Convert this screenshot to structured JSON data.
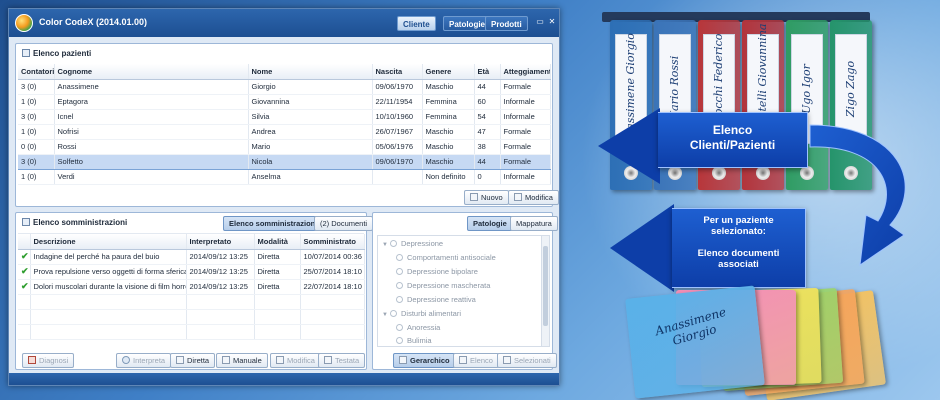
{
  "app": {
    "title": "Color CodeX (2014.01.00)",
    "nav_tabs": [
      "Cliente",
      "Patologie",
      "Prodotti"
    ],
    "active_tab": "Cliente",
    "window_controls": [
      "▭",
      "✕"
    ]
  },
  "patients": {
    "title": "Elenco pazienti",
    "columns": [
      "Contatori",
      "Cognome",
      "Nome",
      "Nascita",
      "Genere",
      "Età",
      "Atteggiamento"
    ],
    "rows": [
      [
        "3 (0)",
        "Anassimene",
        "Giorgio",
        "09/06/1970",
        "Maschio",
        "44",
        "Formale"
      ],
      [
        "1 (0)",
        "Eptagora",
        "Giovannina",
        "22/11/1954",
        "Femmina",
        "60",
        "Informale"
      ],
      [
        "3 (0)",
        "Icnel",
        "Silvia",
        "10/10/1960",
        "Femmina",
        "54",
        "Informale"
      ],
      [
        "1 (0)",
        "Nofrisi",
        "Andrea",
        "26/07/1967",
        "Maschio",
        "47",
        "Formale"
      ],
      [
        "0 (0)",
        "Rossi",
        "Mario",
        "05/06/1976",
        "Maschio",
        "38",
        "Formale"
      ],
      [
        "3 (0)",
        "Solfetto",
        "Nicola",
        "09/06/1970",
        "Maschio",
        "44",
        "Formale"
      ],
      [
        "1 (0)",
        "Verdi",
        "Anselma",
        "",
        "Non definito",
        "0",
        "Informale"
      ]
    ],
    "selected_row": 5,
    "new_button": "Nuovo",
    "edit_button": "Modifica"
  },
  "administrations": {
    "title": "Elenco somministrazioni",
    "tab_active": "Elenco somministrazioni",
    "tab_documents": "(2) Documenti",
    "columns": [
      "Descrizione",
      "Interpretato",
      "Modalità",
      "Somministrato"
    ],
    "rows": [
      [
        "Indagine del perché ha paura del buio",
        "2014/09/12 13:25",
        "Diretta",
        "10/07/2014 00:36"
      ],
      [
        "Prova repulsione verso oggetti di forma sferica",
        "2014/09/12 13:25",
        "Diretta",
        "25/07/2014 18:10"
      ],
      [
        "Dolori muscolari durante la visione di film horror.",
        "2014/09/12 13:25",
        "Diretta",
        "22/07/2014 18:10"
      ]
    ],
    "buttons": {
      "diagnosi": "Diagnosi",
      "interpreta": "Interpreta",
      "diretta": "Diretta",
      "manuale": "Manuale",
      "modifica": "Modifica",
      "testata": "Testata"
    }
  },
  "pathologies": {
    "tab_active": "Patologie",
    "tab_map": "Mappatura",
    "tree": [
      {
        "label": "Depressione",
        "level": 0
      },
      {
        "label": "Comportamenti antisociale",
        "level": 1
      },
      {
        "label": "Depressione bipolare",
        "level": 1
      },
      {
        "label": "Depressione mascherata",
        "level": 1
      },
      {
        "label": "Depressione reattiva",
        "level": 1
      },
      {
        "label": "Disturbi alimentari",
        "level": 0
      },
      {
        "label": "Anoressia",
        "level": 1
      },
      {
        "label": "Bulimia",
        "level": 1
      }
    ],
    "buttons": {
      "hierarchical": "Gerarchico",
      "list": "Elenco",
      "selected": "Selezionati"
    }
  },
  "infographic": {
    "binders": [
      {
        "name": "Anassimene\nGiorgio",
        "color": "#2d6fb5"
      },
      {
        "name": "Mario\nRossi",
        "color": "#3b74b8"
      },
      {
        "name": "Parmocchi\nFederico",
        "color": "#b8363a"
      },
      {
        "name": "Formentelli\nGiovannina",
        "color": "#b3343b"
      },
      {
        "name": "Ugo\nIgor",
        "color": "#2f9c63"
      },
      {
        "name": "Zigo\nZago",
        "color": "#25946b"
      }
    ],
    "arrow_clients": "Elenco\nClienti/Pazienti",
    "arrow_documents": "Per un paziente\nselezionato:\n\nElenco documenti\nassociati",
    "folder_label": "Anassimene\nGiorgio",
    "folder_colors": [
      "#5ab1e8",
      "#f28fb7",
      "#f1e25d",
      "#9ad36b",
      "#f4a35c",
      "#f7c15b"
    ]
  }
}
